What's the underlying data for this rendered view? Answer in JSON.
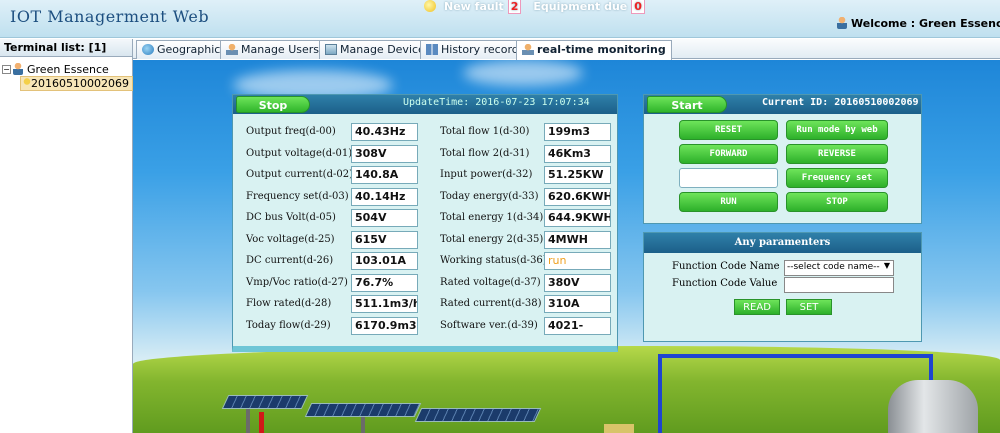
{
  "header": {
    "title": "IOT Managerment Web",
    "new_fault_label": "New fault",
    "new_fault_count": "2",
    "equipment_due_label": "Equipment due",
    "equipment_due_count": "0",
    "welcome": "Welcome : Green Essence :"
  },
  "sidebar": {
    "title": "Terminal list: [1]",
    "root_label": "Green Essence",
    "child_label": "20160510002069"
  },
  "tabs": [
    {
      "label": "Geographic",
      "icon": "globe-icon"
    },
    {
      "label": "Manage Users",
      "icon": "users-icon"
    },
    {
      "label": "Manage Device",
      "icon": "device-icon"
    },
    {
      "label": "History record",
      "icon": "book-icon"
    },
    {
      "label": "real-time monitoring",
      "icon": "user-icon",
      "active": true
    }
  ],
  "status": {
    "stop_label": "Stop",
    "update_time": "UpdateTime: 2016-07-23 17:07:34",
    "left_fields": [
      {
        "label": "Output freq(d-00)",
        "value": "40.43Hz"
      },
      {
        "label": "Output voltage(d-01)",
        "value": "308V"
      },
      {
        "label": "Output current(d-02)",
        "value": "140.8A"
      },
      {
        "label": "Frequency set(d-03)",
        "value": "40.14Hz"
      },
      {
        "label": "DC bus Volt(d-05)",
        "value": "504V"
      },
      {
        "label": "Voc voltage(d-25)",
        "value": "615V"
      },
      {
        "label": "DC current(d-26)",
        "value": "103.01A"
      },
      {
        "label": "Vmp/Voc ratio(d-27)",
        "value": "76.7%"
      },
      {
        "label": "Flow rated(d-28)",
        "value": "511.1m3/h"
      },
      {
        "label": "Today flow(d-29)",
        "value": "6170.9m3"
      }
    ],
    "right_fields": [
      {
        "label": "Total flow 1(d-30)",
        "value": "199m3"
      },
      {
        "label": "Total flow 2(d-31)",
        "value": "46Km3"
      },
      {
        "label": "Input power(d-32)",
        "value": "51.25KW"
      },
      {
        "label": "Today energy(d-33)",
        "value": "620.6KWH"
      },
      {
        "label": "Total energy 1(d-34)",
        "value": "644.9KWH"
      },
      {
        "label": "Total energy 2(d-35)",
        "value": "4MWH"
      },
      {
        "label": "Working status(d-36)",
        "value": "run"
      },
      {
        "label": "Rated voltage(d-37)",
        "value": "380V"
      },
      {
        "label": "Rated current(d-38)",
        "value": "310A"
      },
      {
        "label": "Software ver.(d-39)",
        "value": "4021-"
      }
    ]
  },
  "control": {
    "start_label": "Start",
    "current_id": "Current ID: 20160510002069",
    "reset": "RESET",
    "run_mode": "Run mode by web",
    "forward": "FORWARD",
    "reverse": "REVERSE",
    "frequency_set": "Frequency set",
    "run": "RUN",
    "stop": "STOP"
  },
  "params": {
    "title": "Any paramenters",
    "code_name_label": "Function Code Name",
    "code_value_label": "Function Code Value",
    "select_value": "--select code name--",
    "read": "READ",
    "set": "SET"
  }
}
